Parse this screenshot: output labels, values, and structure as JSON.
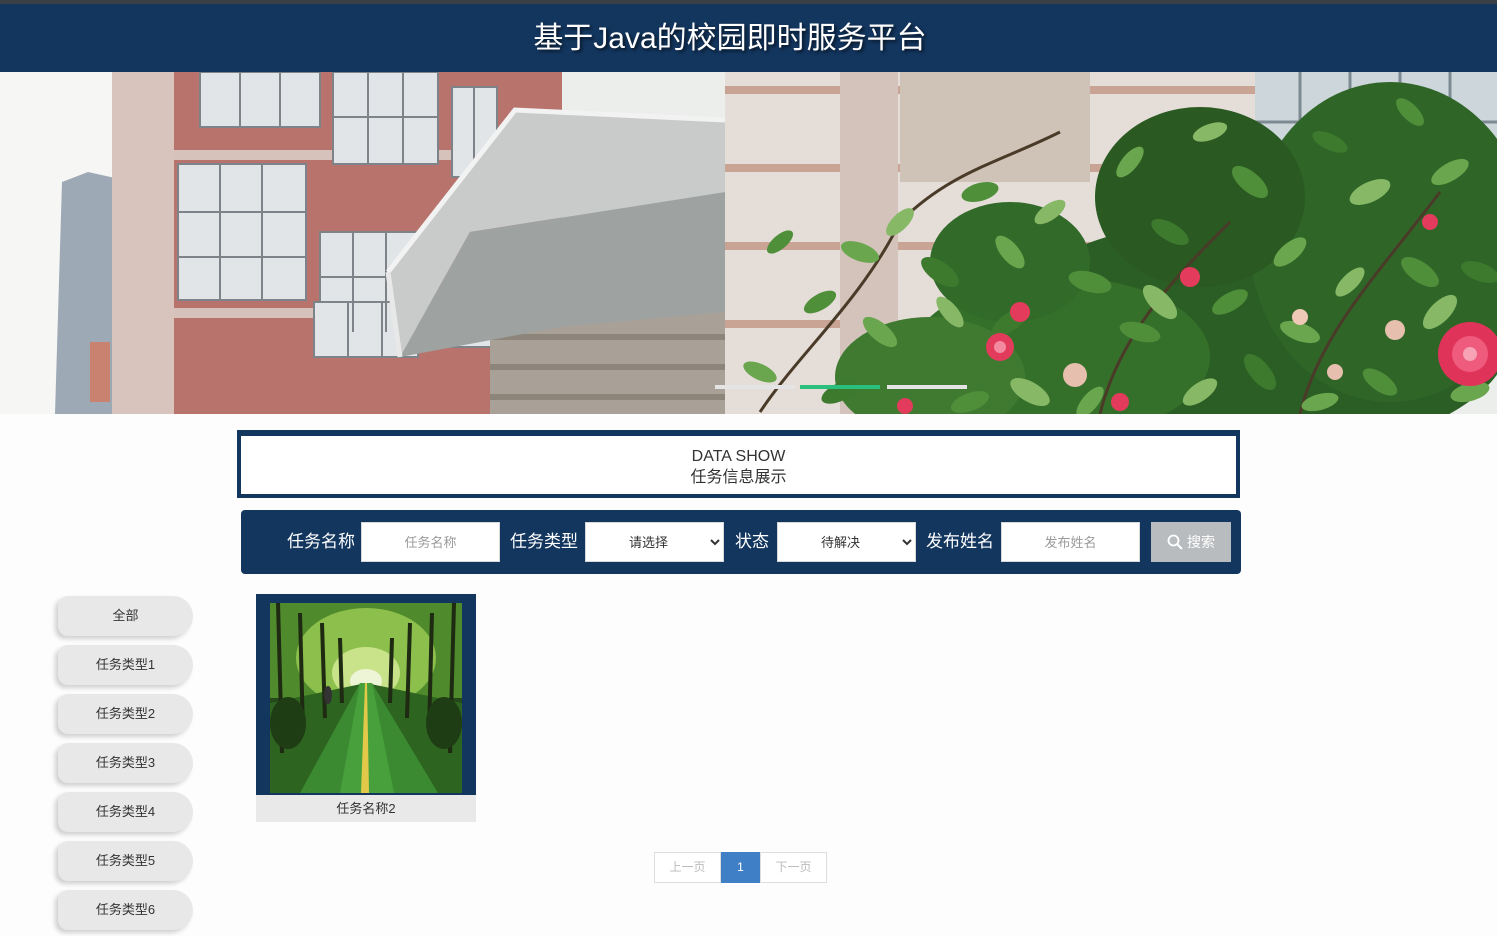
{
  "header": {
    "title": "基于Java的校园即时服务平台"
  },
  "carousel": {
    "slide_count": 3,
    "active_index": 1
  },
  "section": {
    "title_en": "DATA SHOW",
    "title_cn": "任务信息展示"
  },
  "search": {
    "name_label": "任务名称",
    "name_placeholder": "任务名称",
    "type_label": "任务类型",
    "type_value": "请选择",
    "status_label": "状态",
    "status_value": "待解决",
    "publisher_label": "发布姓名",
    "publisher_placeholder": "发布姓名",
    "button_label": "搜索",
    "button_icon": "search-icon"
  },
  "categories": [
    "全部",
    "任务类型1",
    "任务类型2",
    "任务类型3",
    "任务类型4",
    "任务类型5",
    "任务类型6"
  ],
  "tasks": [
    {
      "name": "任务名称2"
    }
  ],
  "pagination": {
    "prev": "上一页",
    "current": "1",
    "next": "下一页"
  },
  "colors": {
    "primary_navy": "#13365f",
    "carousel_active": "#2bbf7d",
    "page_active": "#3f7fc6",
    "search_button": "#b9bcbf",
    "category_bg": "#e8e8e8"
  }
}
